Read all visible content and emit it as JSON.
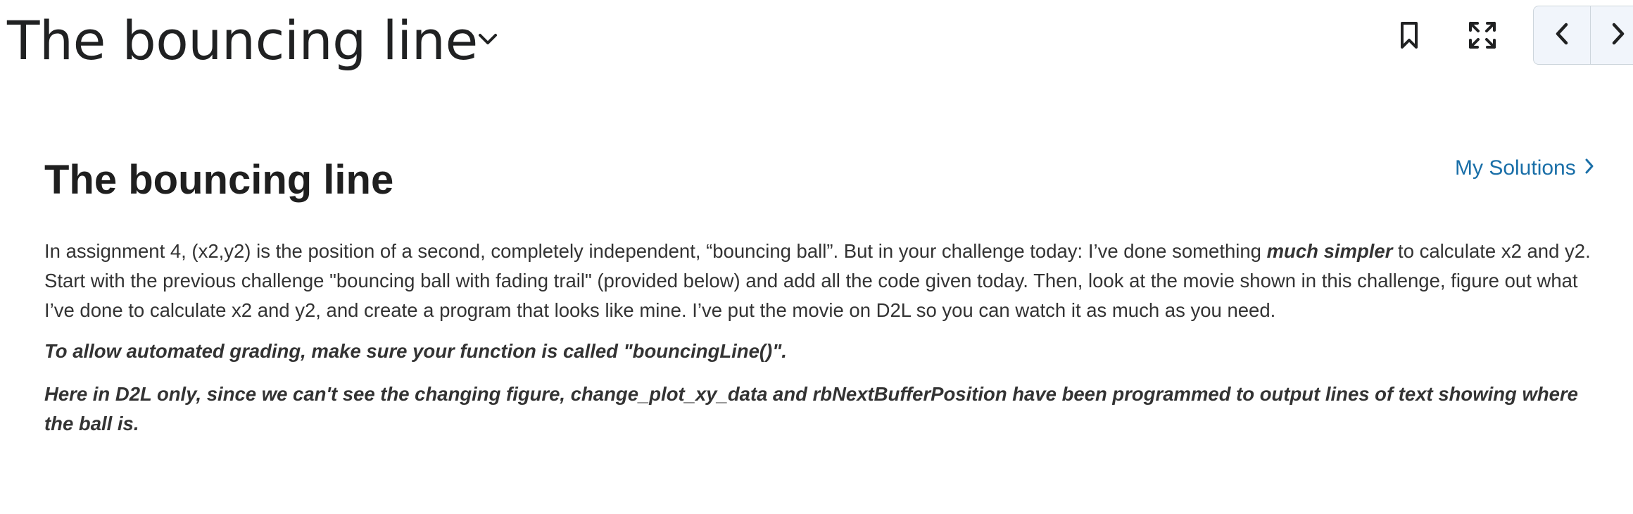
{
  "header": {
    "title": "The bouncing line"
  },
  "content": {
    "title": "The bouncing line",
    "solutions_link": "My Solutions",
    "para1_before": "In assignment 4, (x2,y2) is the position of a second, completely independent, “bouncing ball”.  But in your challenge today: I’ve done something ",
    "para1_emphasis": "much simpler",
    "para1_after": " to calculate x2 and y2. Start with the previous challenge \"bouncing ball with fading trail\" (provided below) and add all the code given today.  Then, look at the movie shown in this challenge,  figure out what I’ve done to calculate x2 and y2, and create a program that looks like mine. I’ve put the movie on D2L so you can watch it as much as you need.",
    "para2": "To allow automated grading, make sure your function is called \"bouncingLine()\".",
    "para3": "Here in D2L only,  since we can't see the changing figure, change_plot_xy_data and rbNextBufferPosition have been programmed to output lines of text showing where the ball is."
  },
  "icons": {
    "title_dropdown": "chevron-down-icon",
    "bookmark": "bookmark-icon",
    "fullscreen": "fullscreen-icon",
    "previous": "chevron-left-icon",
    "next": "chevron-right-icon",
    "solutions": "chevron-right-icon"
  },
  "colors": {
    "link": "#1a6fa8",
    "text": "#333333",
    "nav_background": "#f1f5fb"
  }
}
